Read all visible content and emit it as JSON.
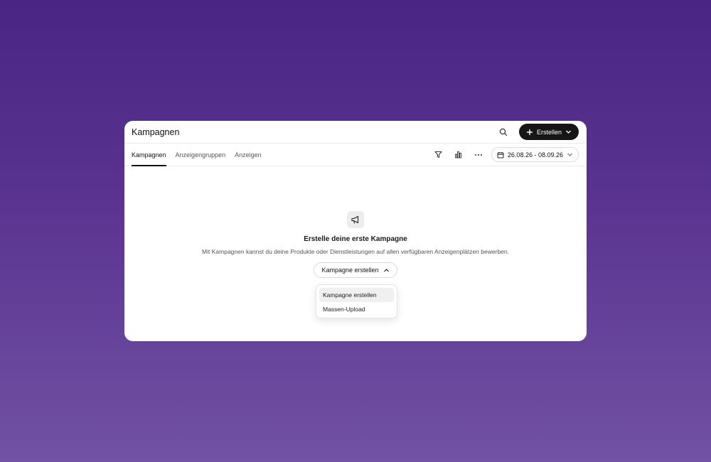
{
  "header": {
    "title": "Kampagnen",
    "search_icon": "search-icon",
    "create_label": "Erstellen",
    "create_icons": [
      "plus-icon",
      "chevron-down-icon"
    ]
  },
  "tabs": [
    {
      "label": "Kampagnen",
      "active": true
    },
    {
      "label": "Anzeigengruppen",
      "active": false
    },
    {
      "label": "Anzeigen",
      "active": false
    }
  ],
  "toolbar": {
    "icons": [
      "filter-icon",
      "bar-chart-icon",
      "more-icon"
    ],
    "date_range": "26.08.26 - 08.09.26"
  },
  "empty_state": {
    "icon": "megaphone-icon",
    "title": "Erstelle deine erste Kampagne",
    "description": "Mit Kampagnen kannst du deine Produkte oder Dienstleistungen auf allen verfügbaren Anzeigenplätzen bewerben.",
    "button_label": "Kampagne erstellen"
  },
  "dropdown": {
    "items": [
      {
        "label": "Kampagne erstellen",
        "highlighted": true
      },
      {
        "label": "Massen-Upload",
        "highlighted": false
      }
    ]
  },
  "colors": {
    "background_top": "#4a2583",
    "background_bottom": "#7152a3",
    "primary_button": "#161616"
  }
}
